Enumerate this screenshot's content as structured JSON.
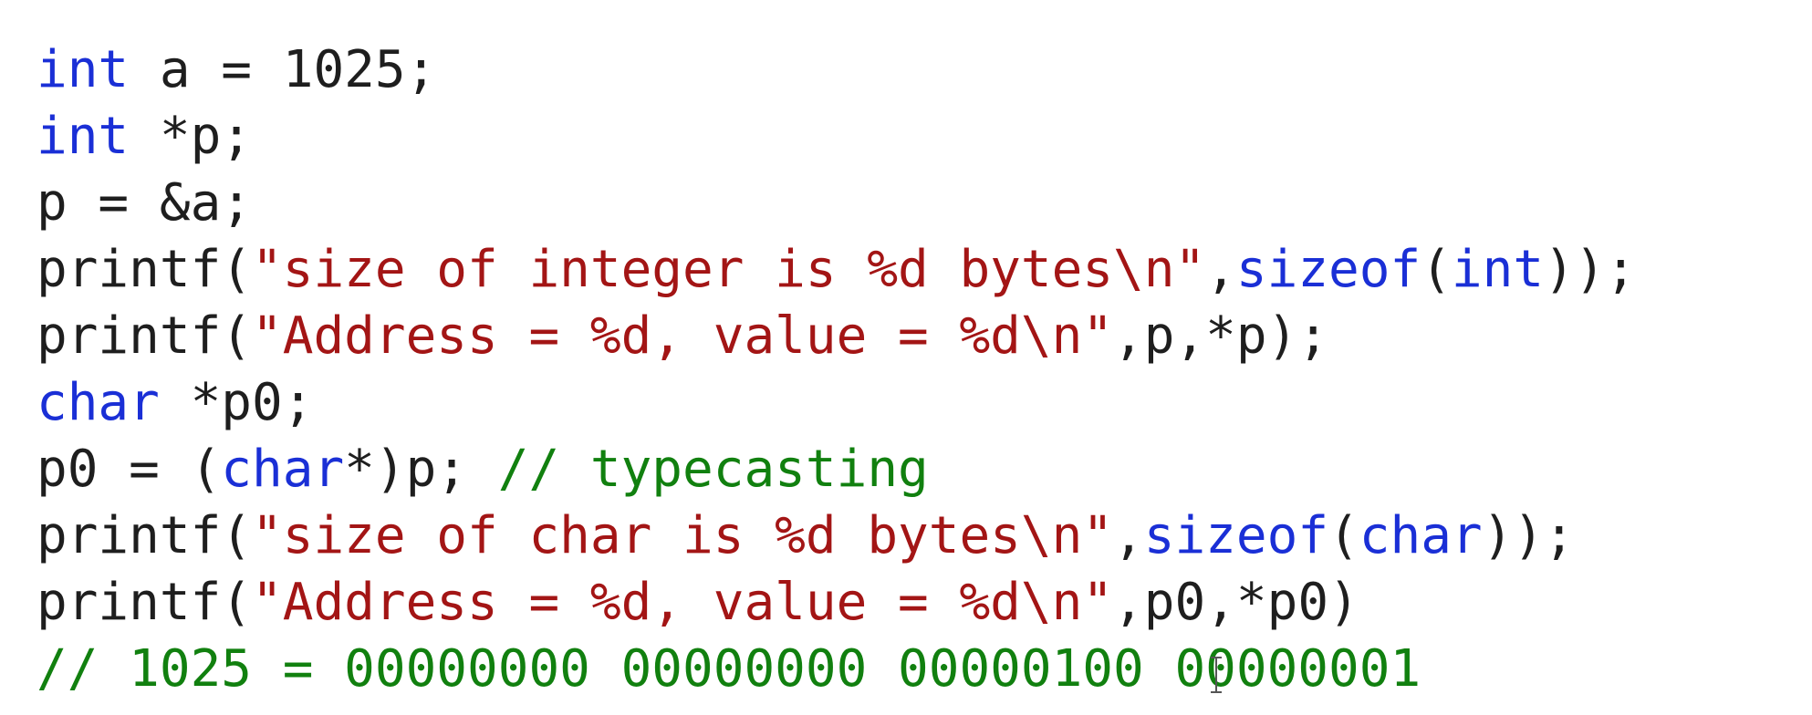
{
  "editor": {
    "lines": [
      [
        {
          "t": "int",
          "c": "kw"
        },
        {
          "t": " a = 1025;",
          "c": "pl"
        }
      ],
      [
        {
          "t": "int",
          "c": "kw"
        },
        {
          "t": " *p;",
          "c": "pl"
        }
      ],
      [
        {
          "t": "p = &a;",
          "c": "pl"
        }
      ],
      [
        {
          "t": "printf(",
          "c": "pl"
        },
        {
          "t": "\"size of integer is %d bytes\\n\"",
          "c": "str"
        },
        {
          "t": ",",
          "c": "pl"
        },
        {
          "t": "sizeof",
          "c": "kw"
        },
        {
          "t": "(",
          "c": "pl"
        },
        {
          "t": "int",
          "c": "kw"
        },
        {
          "t": "));",
          "c": "pl"
        }
      ],
      [
        {
          "t": "printf(",
          "c": "pl"
        },
        {
          "t": "\"Address = %d, value = %d\\n\"",
          "c": "str"
        },
        {
          "t": ",p,*p);",
          "c": "pl"
        }
      ],
      [
        {
          "t": "char",
          "c": "kw"
        },
        {
          "t": " *p0;",
          "c": "pl"
        }
      ],
      [
        {
          "t": "p0 = (",
          "c": "pl"
        },
        {
          "t": "char",
          "c": "kw"
        },
        {
          "t": "*)p; ",
          "c": "pl"
        },
        {
          "t": "// typecasting",
          "c": "cm"
        }
      ],
      [
        {
          "t": "printf(",
          "c": "pl"
        },
        {
          "t": "\"size of char is %d bytes\\n\"",
          "c": "str"
        },
        {
          "t": ",",
          "c": "pl"
        },
        {
          "t": "sizeof",
          "c": "kw"
        },
        {
          "t": "(",
          "c": "pl"
        },
        {
          "t": "char",
          "c": "kw"
        },
        {
          "t": "));",
          "c": "pl"
        }
      ],
      [
        {
          "t": "printf(",
          "c": "pl"
        },
        {
          "t": "\"Address = %d, value = %d\\n\"",
          "c": "str"
        },
        {
          "t": ",p0,*p0)",
          "c": "pl"
        }
      ],
      [
        {
          "t": "// 1025 = 00000000 00000000 00000100 00000001",
          "c": "cm"
        }
      ]
    ]
  },
  "colors": {
    "keyword": "#1a2fd6",
    "string": "#a31515",
    "comment": "#11800f",
    "plain": "#1e1e1e",
    "background": "#ffffff"
  },
  "icons": {
    "cursor": "text-ibeam-cursor-icon"
  }
}
